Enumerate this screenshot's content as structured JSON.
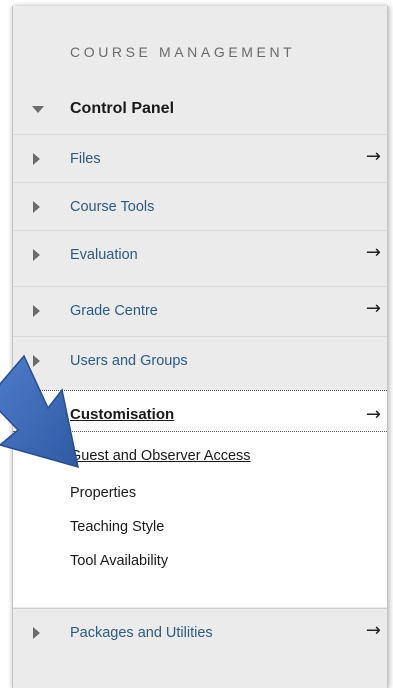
{
  "panel": {
    "heading": "COURSE MANAGEMENT",
    "control_panel_label": "Control Panel"
  },
  "nav": {
    "files": "Files",
    "course_tools": "Course Tools",
    "evaluation": "Evaluation",
    "grade_centre": "Grade Centre",
    "users_and_groups": "Users and Groups",
    "customisation": "Customisation",
    "packages_and_utilities": "Packages and Utilities"
  },
  "customisation_items": {
    "guest_and_observer_access": "Guest and Observer Access",
    "properties": "Properties",
    "teaching_style": "Teaching Style",
    "tool_availability": "Tool Availability"
  },
  "icons": {
    "arrow_glyph": "→"
  },
  "colors": {
    "link": "#2c5a82",
    "panel_bg": "#ebebeb",
    "callout_arrow": "#3b68b5"
  }
}
